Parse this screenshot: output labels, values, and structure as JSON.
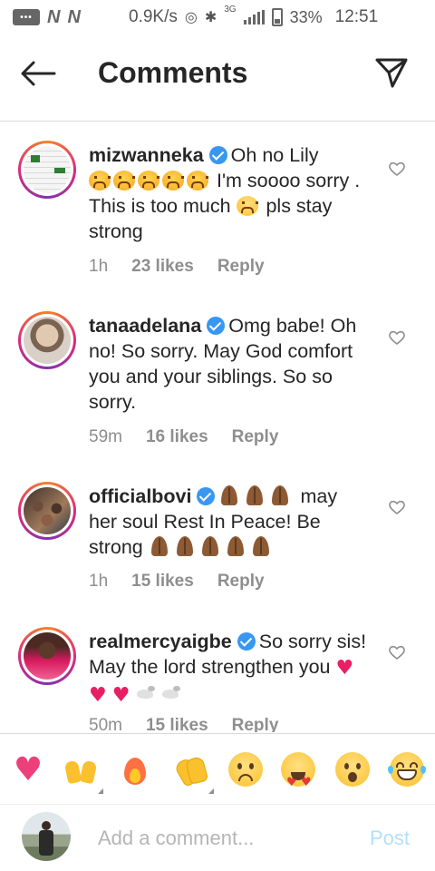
{
  "status_bar": {
    "speed": "0.9K/s",
    "network": "3G",
    "battery": "33%",
    "time": "12:51",
    "icons": [
      "notification-box-icon",
      "n-app-icon",
      "n-app-icon",
      "hotspot-icon",
      "bluetooth-icon",
      "signal-icon",
      "battery-icon"
    ]
  },
  "header": {
    "title": "Comments",
    "back_icon": "arrow-left-icon",
    "share_icon": "paper-plane-icon"
  },
  "comments": [
    {
      "username": "mizwanneka",
      "verified": true,
      "text_a": "Oh no Lily",
      "text_b": " I'm soooo sorry . This is too much ",
      "text_c": " pls stay strong",
      "emoji_a": [
        "persevering-face",
        "persevering-face",
        "persevering-face",
        "persevering-face",
        "persevering-face"
      ],
      "emoji_b": [
        "sad-face"
      ],
      "time": "1h",
      "likes": "23 likes",
      "reply": "Reply"
    },
    {
      "username": "tanaadelana",
      "verified": true,
      "text_a": "Omg babe! Oh no! So sorry. May God comfort you and your siblings. So so sorry.",
      "time": "59m",
      "likes": "16 likes",
      "reply": "Reply"
    },
    {
      "username": "officialbovi",
      "verified": true,
      "text_a": " may her soul Rest In Peace! Be strong ",
      "emoji_a": [
        "folded-hands",
        "folded-hands",
        "folded-hands"
      ],
      "emoji_b": [
        "folded-hands",
        "folded-hands",
        "folded-hands",
        "folded-hands",
        "folded-hands"
      ],
      "time": "1h",
      "likes": "15 likes",
      "reply": "Reply"
    },
    {
      "username": "realmercyaigbe",
      "verified": true,
      "text_a": "So sorry sis! May the lord strengthen you ",
      "emoji_a": [
        "heart",
        "heart",
        "heart",
        "dove",
        "dove"
      ],
      "time": "50m",
      "likes": "15 likes",
      "reply": "Reply"
    }
  ],
  "emoji_bar": [
    "heart",
    "raising-hands",
    "fire",
    "clapping-hands",
    "sad-face",
    "heart-eyes-face",
    "astonished-face",
    "grinning-tears-face"
  ],
  "composer": {
    "placeholder": "Add a comment...",
    "post_label": "Post"
  },
  "colors": {
    "verified": "#3897f0",
    "post_disabled": "#b2dffc",
    "meta_text": "#8e8e8e",
    "heart_emoji": "#ec407a"
  }
}
